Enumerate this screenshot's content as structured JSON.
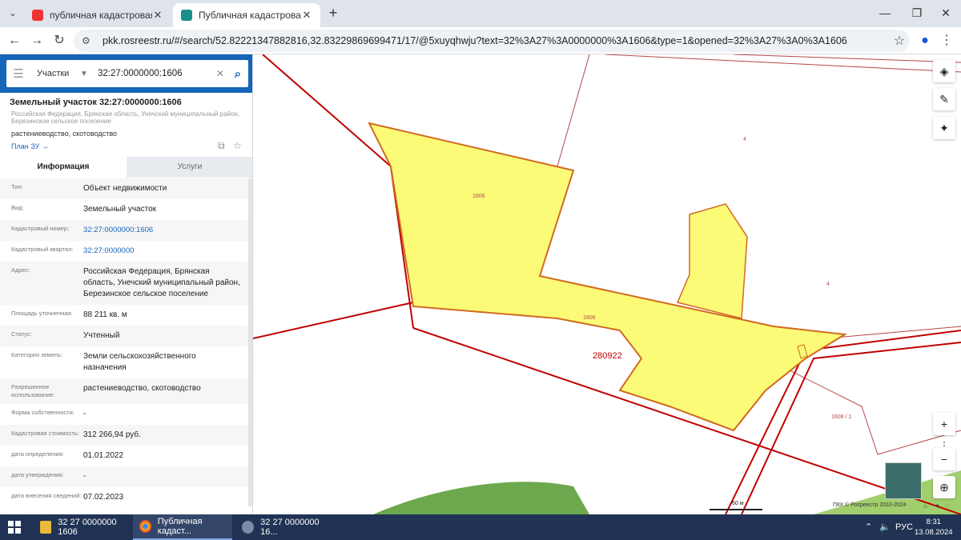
{
  "browser": {
    "tabs": [
      {
        "title": "публичная кадастровая карта"
      },
      {
        "title": "Публичная кадастровая карта"
      }
    ],
    "url": "pkk.rosreestr.ru/#/search/52.82221347882816,32.83229869699471/17/@5xuyqhwju?text=32%3A27%3A0000000%3A1606&type=1&opened=32%3A27%3A0%3A1606"
  },
  "search": {
    "category": "Участки",
    "query": "32:27:0000000:1606"
  },
  "parcel": {
    "title": "Земельный участок 32:27:0000000:1606",
    "address_small": "Российская Федерация, Брянская область, Унечский муниципальный район, Березинское сельское поселение",
    "usage": "растениеводство, скотоводство",
    "plan_link": "План ЗУ →"
  },
  "panel_tabs": {
    "info": "Информация",
    "services": "Услуги"
  },
  "rows": [
    {
      "key": "Тип:",
      "value": "Объект недвижимости"
    },
    {
      "key": "Вид:",
      "value": "Земельный участок"
    },
    {
      "key": "Кадастровый номер:",
      "value": "32:27:0000000:1606"
    },
    {
      "key": "Кадастровый квартал:",
      "value": "32:27:0000000"
    },
    {
      "key": "Адрес:",
      "value": "Российская Федерация, Брянская область, Унечский муниципальный район, Березинское сельское поселение"
    },
    {
      "key": "Площадь уточненная:",
      "value": "88 211 кв. м"
    },
    {
      "key": "Статус:",
      "value": "Учтенный"
    },
    {
      "key": "Категория земель:",
      "value": "Земли сельскохозяйственного назначения"
    },
    {
      "key": "Разрешенное использование:",
      "value": "растениеводство, скотоводство"
    },
    {
      "key": "Форма собственности:",
      "value": "-"
    },
    {
      "key": "Кадастровая стоимость:",
      "value": "312 266,94 руб."
    },
    {
      "key": "дата определения:",
      "value": "01.01.2022"
    },
    {
      "key": "дата утверждения:",
      "value": "-"
    },
    {
      "key": "дата внесения сведений:",
      "value": "07.02.2023"
    }
  ],
  "map": {
    "labels": {
      "parcel_a": "1606",
      "parcel_b": "1606",
      "block": "280922",
      "area_4a": "4",
      "area_4b": "4",
      "parcel_1608": "1608 / 1"
    },
    "scale": "60 м",
    "copyright": "ПКК © Росреестр 2010-2024",
    "colors": {
      "parcel_fill": "#fbfb78",
      "parcel_border": "#d2691e",
      "block_border": "#c00000",
      "field": "#6da84f"
    }
  },
  "taskbar": {
    "items": [
      "32 27 0000000 1606",
      "Публичная кадаст...",
      "32  27  0000000  16..."
    ],
    "lang": "РУС",
    "time": "8:31",
    "date": "13.08.2024"
  }
}
